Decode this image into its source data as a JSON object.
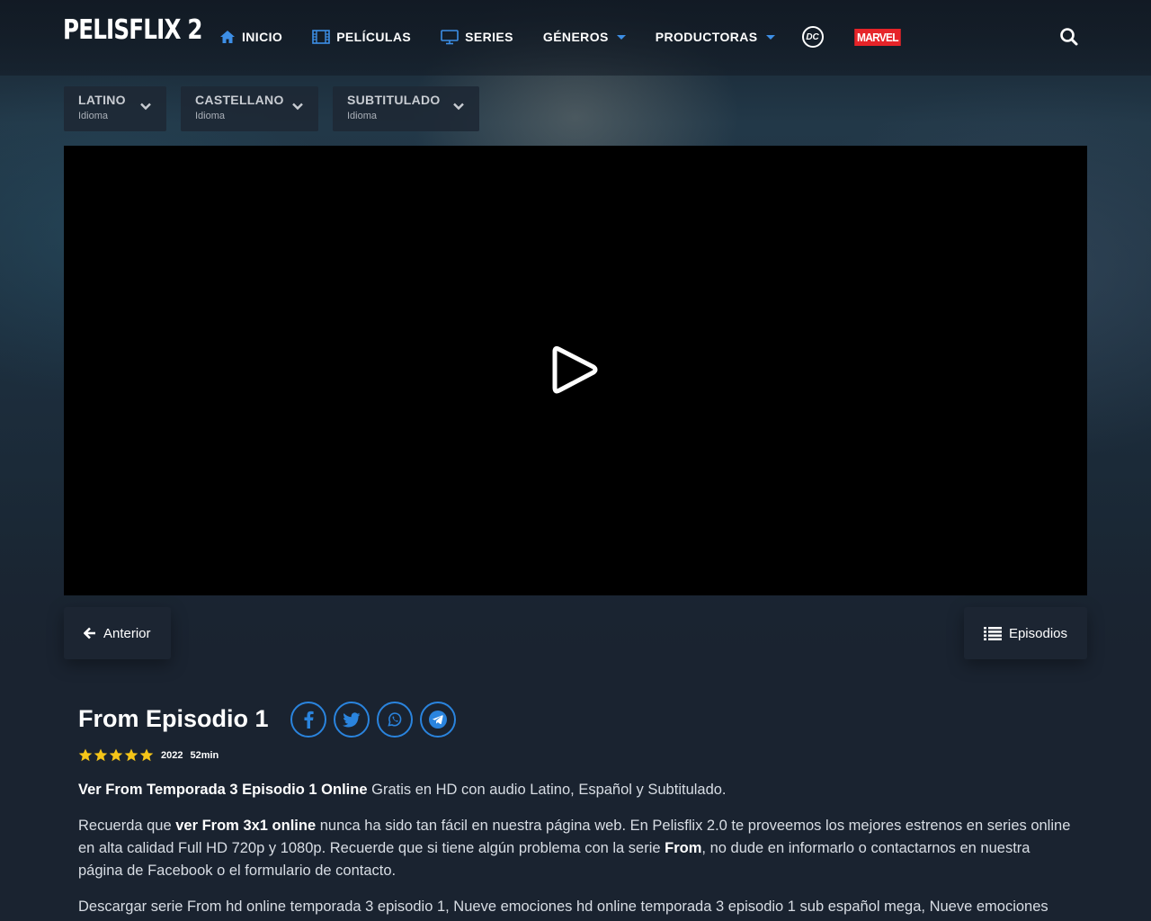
{
  "header": {
    "logo": "PELISFLIX 2",
    "nav": [
      {
        "label": "INICIO",
        "icon": "home-icon"
      },
      {
        "label": "PELÍCULAS",
        "icon": "film-icon"
      },
      {
        "label": "SERIES",
        "icon": "tv-icon"
      },
      {
        "label": "GÉNEROS",
        "icon": "caret-down-icon"
      },
      {
        "label": "PRODUCTORAS",
        "icon": "caret-down-icon"
      }
    ],
    "dc_logo": "DC",
    "marvel_logo": "MARVEL",
    "accent_color": "#3d8fe6"
  },
  "language_tabs": [
    {
      "name": "LATINO",
      "sub": "Idioma"
    },
    {
      "name": "CASTELLANO",
      "sub": "Idioma"
    },
    {
      "name": "SUBTITULADO",
      "sub": "Idioma"
    }
  ],
  "player": {
    "icon": "play-icon"
  },
  "navigation": {
    "prev_label": "Anterior",
    "episodes_label": "Episodios"
  },
  "episode": {
    "title": "From Episodio 1",
    "rating_stars": 5,
    "year": "2022",
    "duration": "52min",
    "share": [
      "facebook-icon",
      "twitter-icon",
      "whatsapp-icon",
      "telegram-icon"
    ]
  },
  "description": {
    "p1_bold": "Ver From Temporada 3 Episodio 1 Online",
    "p1_rest": " Gratis en HD con audio Latino, Español y Subtitulado.",
    "p2_a": "Recuerda que ",
    "p2_bold1": "ver From 3x1 online",
    "p2_b": " nunca ha sido tan fácil en nuestra página web. En Pelisflix 2.0 te proveemos los mejores estrenos en series online en alta calidad Full HD 720p y 1080p. Recuerde que si tiene algún problema con la serie ",
    "p2_bold2": "From",
    "p2_c": ", no dude en informarlo o contactarnos en nuestra página de Facebook o el formulario de contacto.",
    "p3": "Descargar serie From hd online temporada 3 episodio 1, Nueve emociones hd online temporada 3 episodio 1 sub español mega, Nueve emociones"
  }
}
